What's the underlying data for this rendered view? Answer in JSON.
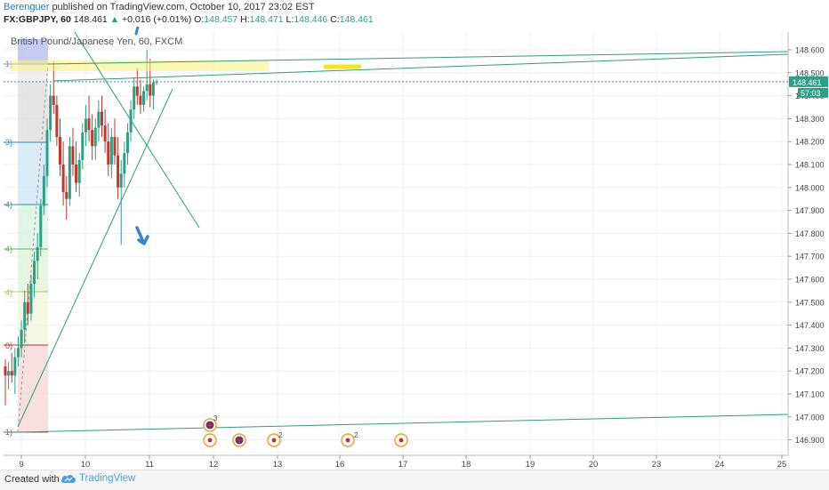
{
  "header": {
    "author": "Berenguer",
    "published_text": "published on TradingView.com, October 10, 2017 23:02 EST"
  },
  "ohlc": {
    "symbol": "FX:GBPJPY, 60",
    "last": "148.461",
    "change": "+0.016 (+0.01%)",
    "o_label": "O:",
    "o": "148.457",
    "h_label": "H:",
    "h": "148.471",
    "l_label": "L:",
    "l": "148.446",
    "c_label": "C:",
    "c": "148.461"
  },
  "chart_data": {
    "type": "candlestick",
    "title": "British Pound/Japanese Yen, 60, FXCM",
    "y_ticks": [
      148.6,
      148.5,
      148.4,
      148.3,
      148.2,
      148.1,
      148.0,
      147.9,
      147.8,
      147.7,
      147.6,
      147.5,
      147.4,
      147.3,
      147.2,
      147.1,
      147.0,
      146.9
    ],
    "y_range": [
      146.85,
      148.68
    ],
    "x_tick_labels": [
      "9",
      "10",
      "11",
      "12",
      "13",
      "16",
      "17",
      "18",
      "19",
      "20",
      "23",
      "24",
      "25"
    ],
    "last_price": "148.461",
    "countdown": "57:03",
    "fib_labels": [
      "1)",
      "0)",
      "4)",
      "4)",
      "4)",
      "3)",
      "1)"
    ],
    "event_markers": [
      "uk-flag",
      "jp",
      "uk-flag",
      "jp",
      "jp",
      "jp"
    ],
    "event_counts": [
      "3",
      "2",
      "2"
    ],
    "ohlc_series": [
      [
        147.22,
        147.25,
        147.05,
        147.18
      ],
      [
        147.18,
        147.24,
        147.12,
        147.2
      ],
      [
        147.2,
        147.28,
        147.15,
        147.18
      ],
      [
        147.18,
        147.3,
        147.1,
        147.26
      ],
      [
        147.26,
        147.35,
        147.22,
        147.3
      ],
      [
        147.3,
        147.42,
        147.26,
        147.38
      ],
      [
        147.38,
        147.55,
        147.32,
        147.5
      ],
      [
        147.5,
        147.58,
        147.4,
        147.45
      ],
      [
        147.45,
        147.62,
        147.42,
        147.58
      ],
      [
        147.58,
        147.72,
        147.52,
        147.68
      ],
      [
        147.68,
        147.8,
        147.6,
        147.74
      ],
      [
        147.74,
        147.95,
        147.7,
        147.92
      ],
      [
        147.92,
        148.1,
        147.88,
        148.05
      ],
      [
        148.05,
        148.3,
        148.0,
        148.25
      ],
      [
        148.25,
        148.45,
        148.2,
        148.4
      ],
      [
        148.4,
        148.55,
        148.32,
        148.36
      ],
      [
        148.36,
        148.4,
        148.18,
        148.22
      ],
      [
        148.22,
        148.3,
        148.05,
        148.1
      ],
      [
        148.1,
        148.2,
        147.92,
        147.98
      ],
      [
        147.98,
        148.05,
        147.86,
        147.95
      ],
      [
        147.95,
        148.22,
        147.92,
        148.18
      ],
      [
        148.18,
        148.26,
        148.05,
        148.1
      ],
      [
        148.1,
        148.2,
        147.98,
        148.02
      ],
      [
        148.02,
        148.15,
        147.96,
        148.12
      ],
      [
        148.12,
        148.28,
        148.08,
        148.24
      ],
      [
        148.24,
        148.36,
        148.18,
        148.3
      ],
      [
        148.3,
        148.4,
        148.2,
        148.25
      ],
      [
        148.25,
        148.32,
        148.12,
        148.18
      ],
      [
        148.18,
        148.3,
        148.12,
        148.26
      ],
      [
        148.26,
        148.38,
        148.2,
        148.33
      ],
      [
        148.33,
        148.4,
        148.22,
        148.27
      ],
      [
        148.27,
        148.34,
        148.15,
        148.2
      ],
      [
        148.2,
        148.28,
        148.05,
        148.1
      ],
      [
        148.1,
        148.26,
        148.04,
        148.22
      ],
      [
        148.22,
        148.3,
        148.1,
        148.14
      ],
      [
        148.14,
        148.22,
        147.95,
        148.0
      ],
      [
        148.0,
        148.12,
        147.75,
        148.06
      ],
      [
        148.06,
        148.2,
        148.0,
        148.15
      ],
      [
        148.15,
        148.28,
        148.1,
        148.24
      ],
      [
        148.24,
        148.38,
        148.2,
        148.34
      ],
      [
        148.34,
        148.48,
        148.3,
        148.44
      ],
      [
        148.44,
        148.52,
        148.36,
        148.4
      ],
      [
        148.4,
        148.47,
        148.32,
        148.36
      ],
      [
        148.36,
        148.44,
        148.33,
        148.42
      ],
      [
        148.42,
        148.6,
        148.38,
        148.45
      ],
      [
        148.45,
        148.56,
        148.35,
        148.4
      ],
      [
        148.4,
        148.47,
        148.34,
        148.458
      ],
      [
        148.457,
        148.471,
        148.446,
        148.461
      ]
    ]
  },
  "footer": {
    "created_with": "Created with",
    "brand": "TradingView"
  },
  "colors": {
    "bull": "#2c9f84",
    "bear": "#c0392b",
    "trendline": "#2e9e7e",
    "grid": "#eef0f3",
    "arrow": "#3a86c8",
    "highlight": "#f7f27a"
  }
}
